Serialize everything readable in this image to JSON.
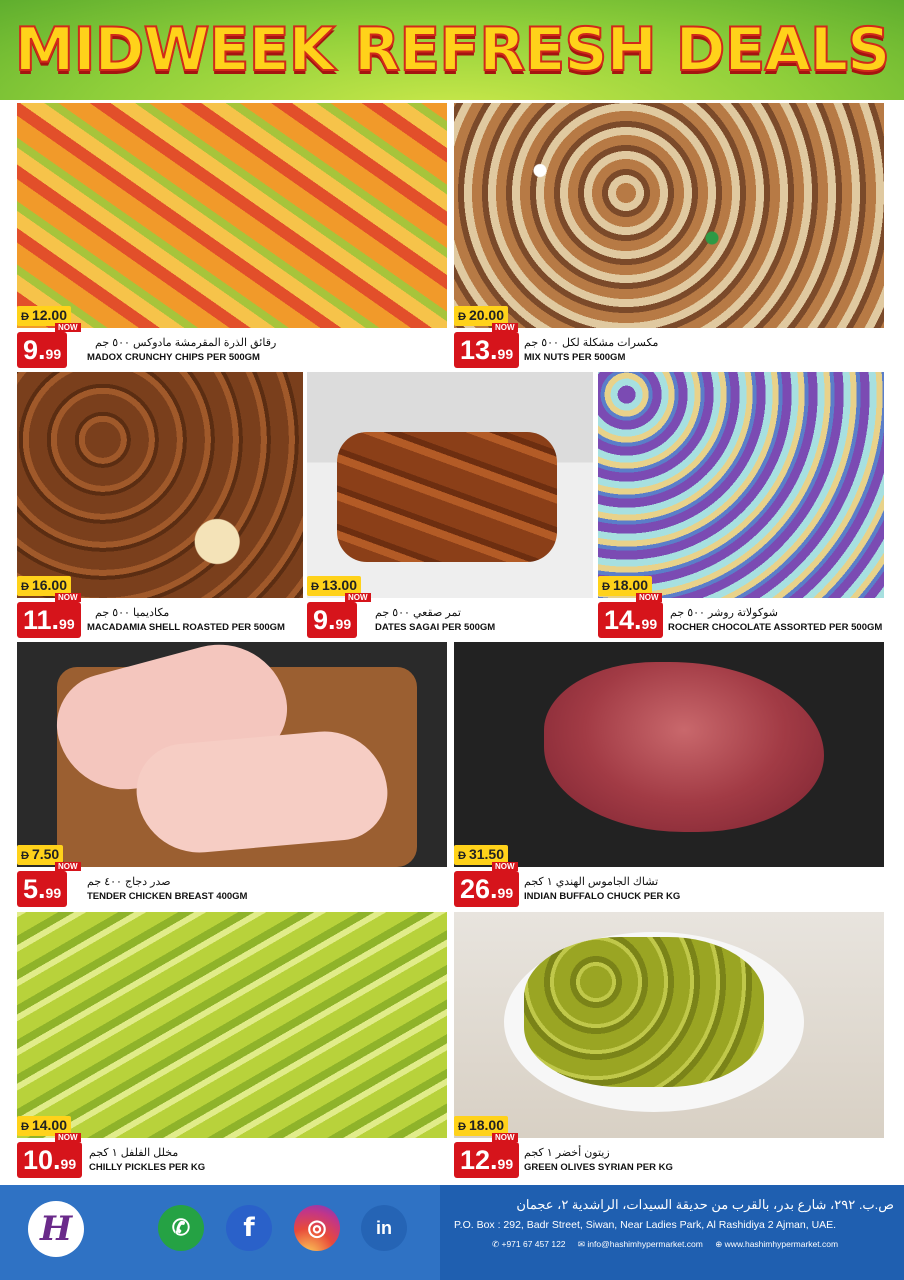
{
  "banner": {
    "title": "MIDWEEK REFRESH DEALS"
  },
  "currency": "D",
  "now_label": "NOW",
  "products": [
    {
      "old": "12.00",
      "price_int": "9.",
      "price_dec": "99",
      "ar": "رقائق الذرة المقرمشة مادوكس ٥٠٠ جم",
      "en": "MADOX CRUNCHY CHIPS  PER 500GM"
    },
    {
      "old": "20.00",
      "price_int": "13.",
      "price_dec": "99",
      "ar": "مكسرات مشكلة لكل ٥٠٠ جم",
      "en": "MIX NUTS PER 500GM"
    },
    {
      "old": "16.00",
      "price_int": "11.",
      "price_dec": "99",
      "ar": "مكاديميا ٥٠٠ جم",
      "en": "MACADAMIA SHELL ROASTED PER 500GM"
    },
    {
      "old": "13.00",
      "price_int": "9.",
      "price_dec": "99",
      "ar": "تمر صقعي ٥٠٠ جم",
      "en": "DATES SAGAI PER 500GM"
    },
    {
      "old": "18.00",
      "price_int": "14.",
      "price_dec": "99",
      "ar": "شوكولاتة روشر ٥٠٠ جم",
      "en": "ROCHER CHOCOLATE ASSORTED PER 500GM"
    },
    {
      "old": "7.50",
      "price_int": "5.",
      "price_dec": "99",
      "ar": "صدر دجاج ٤٠٠ جم",
      "en": "TENDER CHICKEN BREAST 400GM"
    },
    {
      "old": "31.50",
      "price_int": "26.",
      "price_dec": "99",
      "ar": "تشاك الجاموس الهندي ١ كجم",
      "en": "INDIAN BUFFALO CHUCK PER KG"
    },
    {
      "old": "14.00",
      "price_int": "10.",
      "price_dec": "99",
      "ar": "مخلل الفلفل ١ كجم",
      "en": "CHILLY PICKLES PER KG"
    },
    {
      "old": "18.00",
      "price_int": "12.",
      "price_dec": "99",
      "ar": "زيتون أخضر ١ كجم",
      "en": "GREEN OLIVES SYRIAN PER KG"
    }
  ],
  "footer": {
    "logo_letter": "H",
    "address_ar": "ص.ب. ٢٩٢، شارع بدر، بالقرب من حديقة السيدات، الراشدية ٢، عجمان",
    "address_en": "P.O. Box : 292, Badr Street, Siwan, Near Ladies Park, Al Rashidiya 2  Ajman, UAE.",
    "phone": "+971 67 457 122",
    "email": "info@hashimhypermarket.com",
    "website": "www.hashimhypermarket.com",
    "social": [
      {
        "icon": "whatsapp-icon",
        "color": "#25a244",
        "glyph": "✆"
      },
      {
        "icon": "facebook-icon",
        "color": "#2a61c9",
        "glyph": "f"
      },
      {
        "icon": "instagram-icon",
        "color": "#d1306e",
        "glyph": "◎"
      },
      {
        "icon": "linkedin-icon",
        "color": "#2564b5",
        "glyph": "in"
      }
    ]
  }
}
